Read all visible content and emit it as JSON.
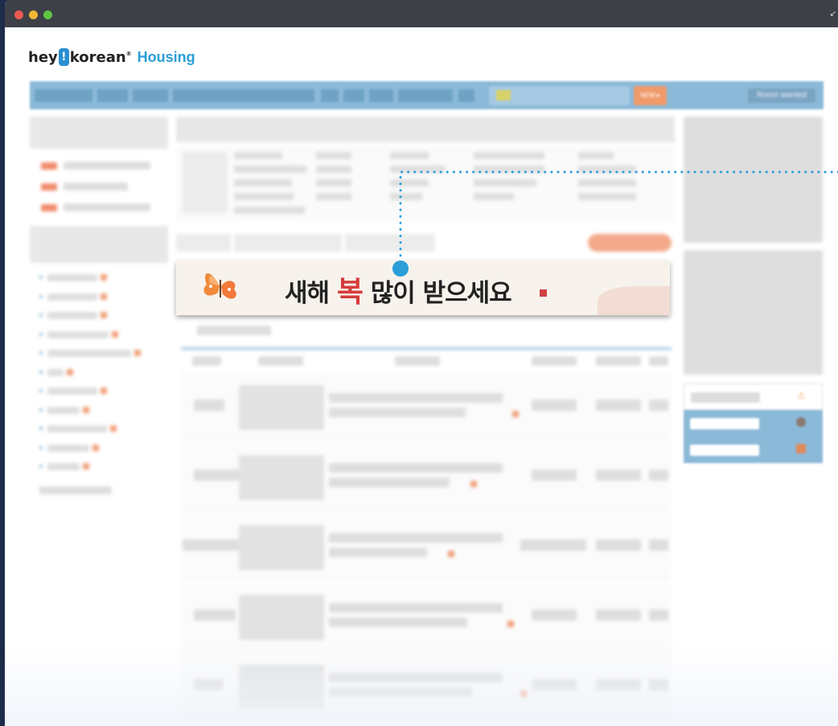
{
  "window": {
    "controls": [
      "close",
      "minimize",
      "maximize"
    ],
    "resize_icon": "resize-arrows-icon"
  },
  "logo": {
    "brand_prefix": "hey",
    "brand_mark": "!",
    "brand_suffix": "korean",
    "registered": "®",
    "section": "Housing"
  },
  "navbar": {
    "new_button": "NEW ▸",
    "room_wanted": "Room wanted",
    "search_icon": "search-icon"
  },
  "banner": {
    "text_before": "새해 ",
    "highlight": "복",
    "text_after": " 많이 받으세요",
    "decoration": "butterfly-icon",
    "accent_color": "#d53c3c"
  },
  "callout": {
    "color": "#2a9ed8",
    "style": "dotted-line-with-dot"
  },
  "colors": {
    "nav_blue": "#8bb9d8",
    "brand_blue": "#2a9ed8",
    "accent_orange": "#f09a6a",
    "titlebar": "#3d4047"
  }
}
